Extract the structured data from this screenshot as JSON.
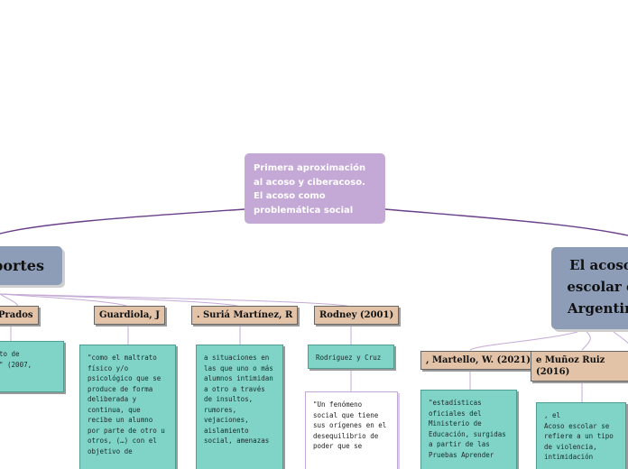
{
  "root": {
    "text": "Primera aproximación al acoso y ciberacoso. El acoso como problemática social"
  },
  "main_left": {
    "text": "portes"
  },
  "main_right": {
    "text": "El acoso escolar e Argentin"
  },
  "authors": {
    "prados": "Prados",
    "guardiola": "Guardiola, J",
    "suria": ". Suriá Martínez, R",
    "rodney": "Rodney (2001)",
    "martello": ", Martello, W. (2021)",
    "munoz": "e Muñoz Ruiz (2016)"
  },
  "notes": {
    "prados_note": "to de\n\" (2007,",
    "guardiola_note": "\"como el maltrato físico y/o psicológico que se produce de forma deliberada y continua, que recibe un alumno por parte de otro u otros, (…) con el objetivo de",
    "suria_note": "a situaciones en las que uno o más alumnos intimidan a otro a través de insultos, rumores, vejaciones, aislamiento social, amenazas",
    "rodney_note": "Rodriguez y Cruz",
    "rodney_quote": "\"Un fenómeno social que tiene sus orígenes en el desequilibrio de poder que se",
    "martello_note": "\"estadísticas oficiales del Ministerio de Educación, surgidas a partir de las Pruebas Aprender",
    "munoz_note": ", el\nAcoso escolar se refiere a un tipo de violencia, intimidación"
  },
  "colors": {
    "root": "#c4a9d6",
    "main_topic": "#8d9db7",
    "author": "#e2c3a8",
    "note": "#7fd3c7",
    "edge": "#c4a9d6",
    "edge_dark": "#6a3f8a"
  }
}
